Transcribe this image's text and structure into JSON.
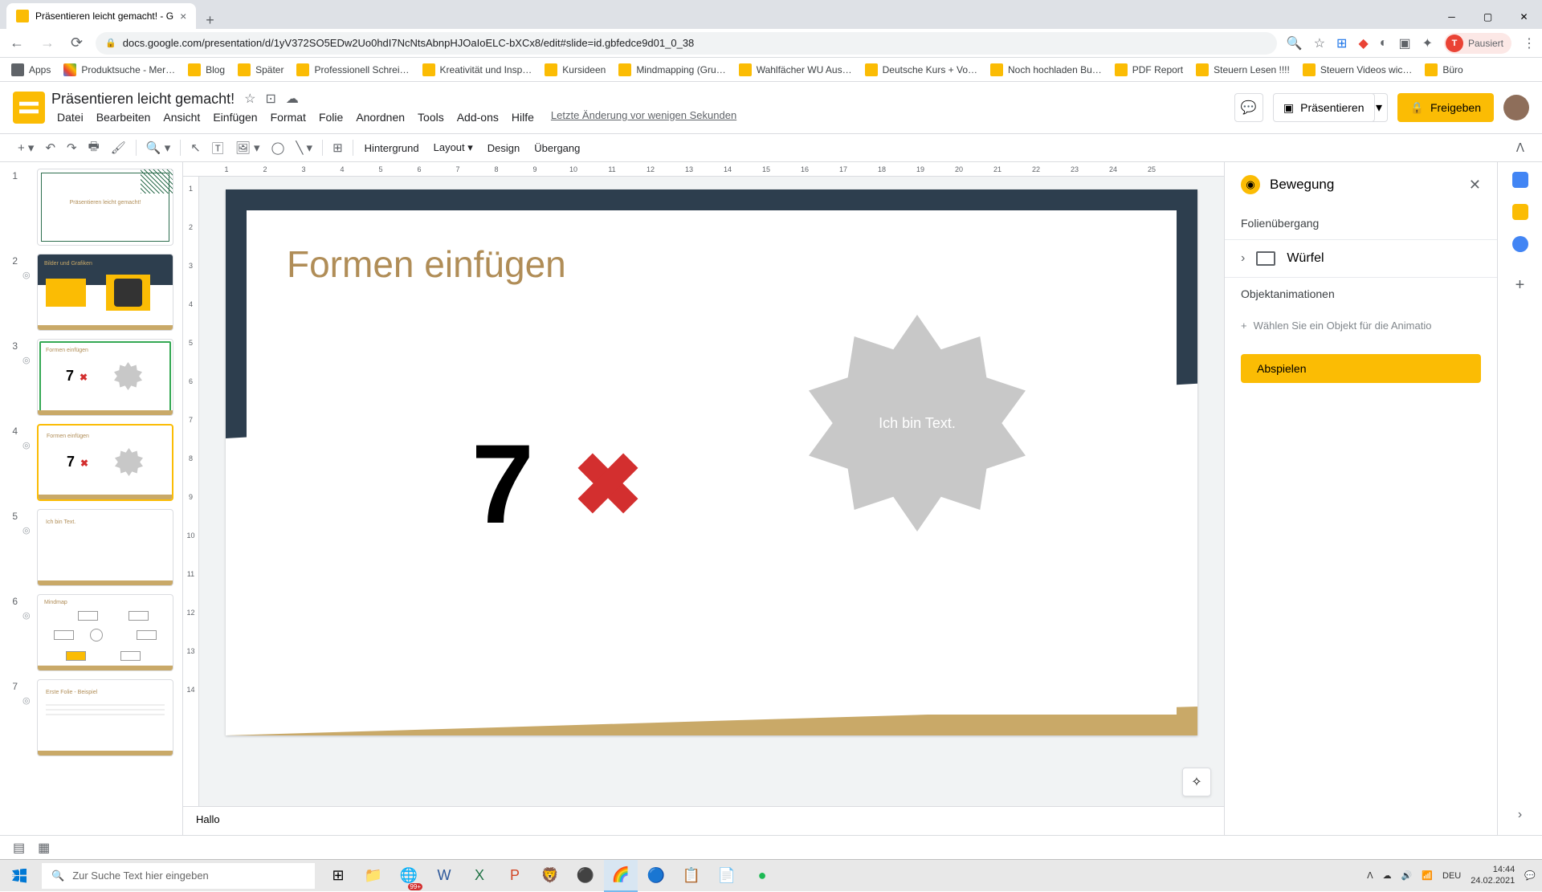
{
  "browser": {
    "tab_title": "Präsentieren leicht gemacht! - G",
    "url": "docs.google.com/presentation/d/1yV372SO5EDw2Uo0hdI7NcNtsAbnpHJOaIoELC-bXCx8/edit#slide=id.gbfedce9d01_0_38",
    "profile_status": "Pausiert"
  },
  "bookmarks": [
    "Apps",
    "Produktsuche - Mer…",
    "Blog",
    "Später",
    "Professionell Schrei…",
    "Kreativität und Insp…",
    "Kursideen",
    "Mindmapping (Gru…",
    "Wahlfächer WU Aus…",
    "Deutsche Kurs + Vo…",
    "Noch hochladen Bu…",
    "PDF Report",
    "Steuern Lesen !!!!",
    "Steuern Videos wic…",
    "Büro"
  ],
  "doc": {
    "title": "Präsentieren leicht gemacht!",
    "last_edit": "Letzte Änderung vor wenigen Sekunden"
  },
  "menus": [
    "Datei",
    "Bearbeiten",
    "Ansicht",
    "Einfügen",
    "Format",
    "Folie",
    "Anordnen",
    "Tools",
    "Add-ons",
    "Hilfe"
  ],
  "header_buttons": {
    "present": "Präsentieren",
    "share": "Freigeben"
  },
  "toolbar": {
    "background": "Hintergrund",
    "layout": "Layout",
    "design": "Design",
    "transition": "Übergang"
  },
  "ruler_h": [
    "1",
    "2",
    "3",
    "4",
    "5",
    "6",
    "7",
    "8",
    "9",
    "10",
    "11",
    "12",
    "13",
    "14",
    "15",
    "16",
    "17",
    "18",
    "19",
    "20",
    "21",
    "22",
    "23",
    "24",
    "25"
  ],
  "ruler_v": [
    "1",
    "2",
    "3",
    "4",
    "5",
    "6",
    "7",
    "8",
    "9",
    "10",
    "11",
    "12",
    "13",
    "14"
  ],
  "slide": {
    "title": "Formen einfügen",
    "seven": "7",
    "star_text": "Ich bin Text."
  },
  "thumbnails": {
    "t1_title": "Präsentieren leicht gemacht!",
    "t2_title": "Bilder und Grafiken",
    "t3_title": "Formen einfügen",
    "t4_title": "Formen einfügen",
    "t5_title": "Ich bin Text.",
    "t6_title": "Mindmap",
    "t7_title": "Erste Folie - Beispiel"
  },
  "notes": "Hallo",
  "motion": {
    "title": "Bewegung",
    "section_transition": "Folienübergang",
    "transition_name": "Würfel",
    "section_object": "Objektanimationen",
    "select_hint": "Wählen Sie ein Objekt für die Animatio",
    "play": "Abspielen"
  },
  "taskbar": {
    "search_placeholder": "Zur Suche Text hier eingeben",
    "lang": "DEU",
    "time": "14:44",
    "date": "24.02.2021",
    "badge": "99+"
  }
}
